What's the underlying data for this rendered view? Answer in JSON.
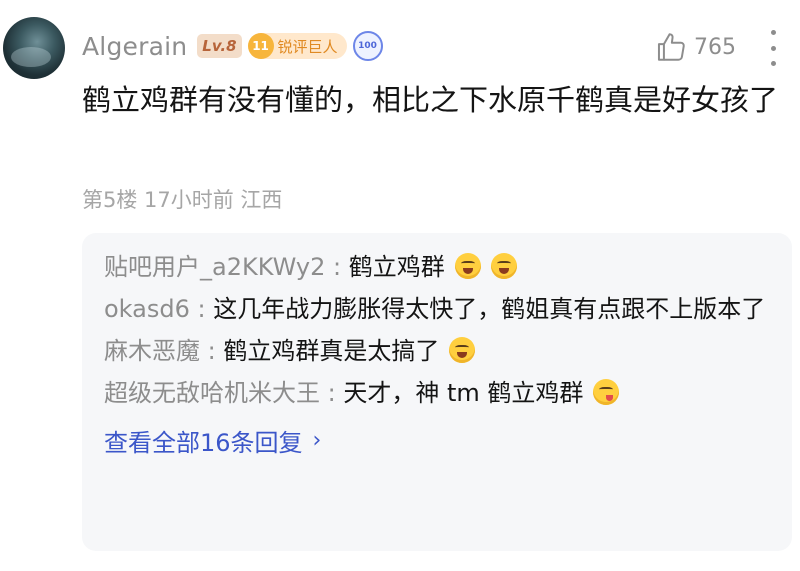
{
  "comment": {
    "username": "Algerain",
    "level_badge": "Lv.8",
    "fan_badge_level": "11",
    "fan_badge_label": "锐评巨人",
    "hundred_badge": "100",
    "like_count": "765",
    "content": "鹤立鸡群有没有懂的，相比之下水原千鹤真是好女孩了",
    "meta": "第5楼 17小时前 江西"
  },
  "replies": [
    {
      "author": "贴吧用户_a2KKWy2",
      "separator": " : ",
      "text": "鹤立鸡群",
      "emojis": [
        "grin-emoji",
        "grin-emoji"
      ]
    },
    {
      "author": "okasd6",
      "separator": " : ",
      "text": "这几年战力膨胀得太快了，鹤姐真有点跟不上版本了",
      "emojis": []
    },
    {
      "author": "麻木恶魔",
      "separator": " : ",
      "text": "鹤立鸡群真是太搞了",
      "emojis": [
        "grin-emoji"
      ]
    },
    {
      "author": "超级无敌哈机米大王",
      "separator": " : ",
      "text": "天才，神 tm 鹤立鸡群",
      "emojis": [
        "yum-emoji"
      ]
    }
  ],
  "view_all_label": "查看全部16条回复",
  "icons": {
    "like": "thumbs-up-icon",
    "more": "more-vertical-icon",
    "chevron": "chevron-right-icon"
  },
  "colors": {
    "link": "#3b56c9",
    "muted": "#8d8d8d",
    "reply_bg": "#f6f7f9"
  }
}
